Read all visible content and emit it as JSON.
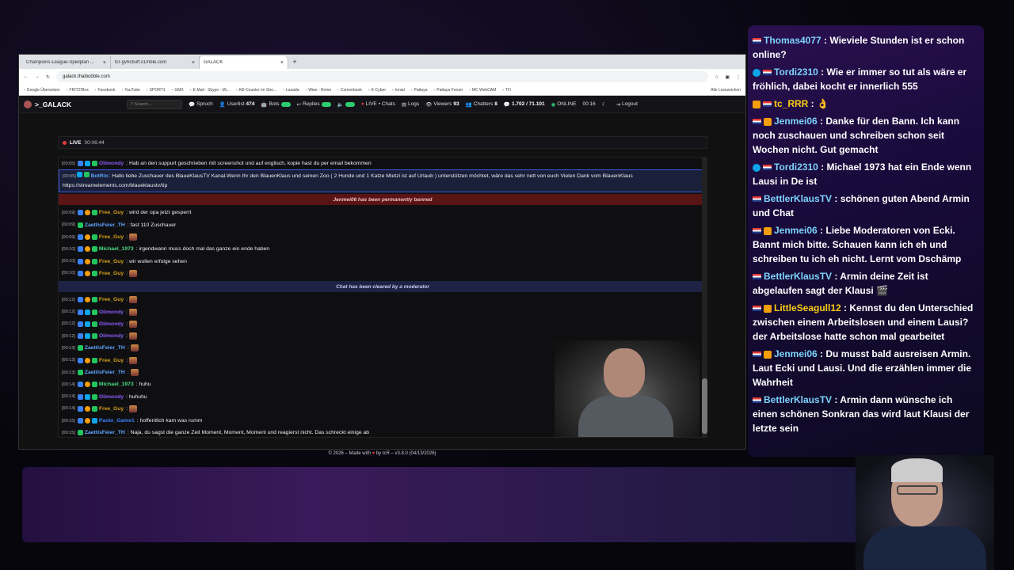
{
  "browser": {
    "tabs": [
      {
        "title": "Champions-League-Spielplan ...",
        "active": false
      },
      {
        "title": "tcr-gvhcbuff.x1mble.com",
        "active": false
      },
      {
        "title": "GALACK",
        "active": true
      }
    ],
    "url": "galack.thaibubble.com",
    "bookmarks": [
      "Google Übersetzer",
      "FRITZ!Box",
      "Facebook",
      "YouTube",
      "SPORT1",
      "GMX",
      "E-Mail - Skype - Mi...",
      "Kill-Counter im Stre...",
      "Lazada",
      "Wise - Home",
      "Comonbank",
      "K-Cyber",
      "Ionial",
      "Pattaya",
      "Pattaya Forum",
      "MC WebCAM",
      "TH"
    ],
    "bookmarks_right": "Alle Lesezeichen"
  },
  "nav": {
    "logo": ">_GALACK",
    "search_placeholder": "Search...",
    "items": {
      "spruch": "Spruch",
      "userlist": "Userlist",
      "userlist_count": "474",
      "bots": "Bots",
      "replies": "Replies",
      "live": "LIVE",
      "chats": "• Chats",
      "logs": "Logs",
      "viewers": "Viewers",
      "viewers_count": "93",
      "chatters": "Chatters",
      "chatters_count": "8",
      "messages": "1.702 / 71.101",
      "online": "ONLINE",
      "time": "00:16",
      "logout": "Logout"
    }
  },
  "livebar": {
    "label": "LIVE",
    "duration": "00:06:44"
  },
  "chat": {
    "messages": [
      {
        "type": "msg",
        "ts": "[00:05]",
        "user": "Olimondy",
        "cls": "u-olimondy",
        "badges": [
          "b-blue",
          "b-sky",
          "b-green"
        ],
        "text": ": Hab an den suppurt geschrieben mit screenshot und auf englisch, kopie hast du per email bekommen"
      },
      {
        "type": "botrix",
        "ts": "[00:05]",
        "user": "BotRix",
        "text": ": Hallo liebe Zuschauer des BlaueKlausTV Kanal.Wenn Ihr den BlauenKlaus und seinen Zoo ( 2 Hunde und 1 Katze Mietzi ist auf Urlaub ) unterstützen möchtet, wäre das sehr nett von euch Vielen Dank vom BlauenKlaus https://streamelements.com/blaueklaustv/tip"
      },
      {
        "type": "banned",
        "text": "Jenmei06 has been permanently banned"
      },
      {
        "type": "msg",
        "ts": "[00:09]",
        "user": "Free_Guy",
        "cls": "u-freeguy",
        "badges": [
          "b-blue",
          "b-orange",
          "b-green"
        ],
        "text": ": wird der opa jetzt gesperrt"
      },
      {
        "type": "msg",
        "ts": "[00:09]",
        "user": "ZaettisFeier_TH",
        "cls": "u-zaettis",
        "badges": [
          "b-green"
        ],
        "text": ": fast 110 Zuschauer"
      },
      {
        "type": "msg",
        "ts": "[00:09]",
        "user": "Free_Guy",
        "cls": "u-freeguy",
        "badges": [
          "b-blue",
          "b-orange",
          "b-green"
        ],
        "text": ":",
        "emote": true
      },
      {
        "type": "msg",
        "ts": "[00:10]",
        "user": "Michael_1973",
        "cls": "u-michael",
        "badges": [
          "b-blue",
          "b-orange",
          "b-green"
        ],
        "text": ": irgendwann muss doch mal das ganze ein ende haben"
      },
      {
        "type": "msg",
        "ts": "[00:10]",
        "user": "Free_Guy",
        "cls": "u-freeguy",
        "badges": [
          "b-blue",
          "b-orange",
          "b-green"
        ],
        "text": ": wir wollen erfolge sehen"
      },
      {
        "type": "msg",
        "ts": "[00:10]",
        "user": "Free_Guy",
        "cls": "u-freeguy",
        "badges": [
          "b-blue",
          "b-orange",
          "b-green"
        ],
        "text": ":",
        "emote": true
      },
      {
        "type": "cleared",
        "text": "Chat has been cleared by a moderator"
      },
      {
        "type": "msg",
        "ts": "[00:12]",
        "user": "Free_Guy",
        "cls": "u-freeguy",
        "badges": [
          "b-blue",
          "b-orange",
          "b-green"
        ],
        "text": ":",
        "emote": true
      },
      {
        "type": "msg",
        "ts": "[00:12]",
        "user": "Olimondy",
        "cls": "u-olimondy",
        "badges": [
          "b-blue",
          "b-sky",
          "b-green"
        ],
        "text": ":",
        "emote": true
      },
      {
        "type": "msg",
        "ts": "[00:12]",
        "user": "Olimondy",
        "cls": "u-olimondy",
        "badges": [
          "b-blue",
          "b-sky",
          "b-green"
        ],
        "text": ":",
        "emote": true
      },
      {
        "type": "msg",
        "ts": "[00:12]",
        "user": "Olimondy",
        "cls": "u-olimondy",
        "badges": [
          "b-blue",
          "b-sky",
          "b-green"
        ],
        "text": ":",
        "emote": true
      },
      {
        "type": "msg",
        "ts": "[00:13]",
        "user": "ZaettisFeier_TH",
        "cls": "u-zaettis",
        "badges": [
          "b-green"
        ],
        "text": ":",
        "emote": true
      },
      {
        "type": "msg",
        "ts": "[00:13]",
        "user": "Free_Guy",
        "cls": "u-freeguy",
        "badges": [
          "b-blue",
          "b-orange",
          "b-green"
        ],
        "text": ":",
        "emote": true
      },
      {
        "type": "msg",
        "ts": "[00:13]",
        "user": "ZaettisFeier_TH",
        "cls": "u-zaettis",
        "badges": [
          "b-green"
        ],
        "text": ":",
        "emote": true
      },
      {
        "type": "msg",
        "ts": "[00:14]",
        "user": "Michael_1973",
        "cls": "u-michael",
        "badges": [
          "b-blue",
          "b-orange",
          "b-green"
        ],
        "text": ": huhu"
      },
      {
        "type": "msg",
        "ts": "[00:14]",
        "user": "Olimondy",
        "cls": "u-olimondy",
        "badges": [
          "b-blue",
          "b-sky",
          "b-green"
        ],
        "text": ": huhuhu"
      },
      {
        "type": "msg",
        "ts": "[00:14]",
        "user": "Free_Guy",
        "cls": "u-freeguy",
        "badges": [
          "b-blue",
          "b-orange",
          "b-green"
        ],
        "text": ":",
        "emote": true
      },
      {
        "type": "msg",
        "ts": "[00:15]",
        "user": "Paolo_Game1",
        "cls": "u-paolo",
        "badges": [
          "b-blue",
          "b-orange",
          "b-sky"
        ],
        "text": ": hoffentlich kam was rumm"
      },
      {
        "type": "msg",
        "ts": "[00:15]",
        "user": "ZaettisFeier_TH",
        "cls": "u-zaettis",
        "badges": [
          "b-green"
        ],
        "text": ": Naja, du sagst die ganze Zeit Moment, Moment, Moment und reagierst nicht. Das schreckt einige ab"
      }
    ]
  },
  "footer": {
    "pre": "© 2026 – Made with",
    "post": "by tcR",
    "version": "– v3.8.0 (04/13/2026)"
  },
  "overlay": {
    "messages": [
      {
        "user": "Thomas4077",
        "cls": "",
        "badge": "flag",
        "text": " : Wieviele Stunden ist er schon online?"
      },
      {
        "user": "Tordi2310",
        "cls": "u-tordi",
        "badge": "blue-flag",
        "text": " : Wie er immer so tut als wäre er fröhlich, dabei kocht er innerlich 555"
      },
      {
        "user": "tc_RRR",
        "cls": "u-tc",
        "badge": "badge-flag",
        "text": " : 👌"
      },
      {
        "user": "Jenmei06",
        "cls": "u-jen",
        "badge": "flag-badge",
        "text": " : Danke für den Bann. Ich kann noch zuschauen und schreiben schon seit Wochen nicht. Gut gemacht"
      },
      {
        "user": "Tordi2310",
        "cls": "u-tordi",
        "badge": "blue-flag",
        "text": " : Michael 1973 hat ein Ende wenn Lausi in De ist"
      },
      {
        "user": "BettlerKlausTV",
        "cls": "u-bettler",
        "badge": "flag",
        "text": " : schönen guten Abend Armin und Chat"
      },
      {
        "user": "Jenmei06",
        "cls": "u-jen",
        "badge": "flag-badge",
        "text": " : Liebe Moderatoren von Ecki. Bannt mich bitte. Schauen kann ich eh und schreiben tu ich eh nicht. Lernt vom Dschämp"
      },
      {
        "user": "BettlerKlausTV",
        "cls": "u-bettler",
        "badge": "flag",
        "text": " : Armin deine Zeit ist abgelaufen sagt der Klausi 🎬"
      },
      {
        "user": "LittleSeagull12",
        "cls": "u-gull",
        "badge": "flag-badge",
        "text": " : Kennst du den Unterschied zwischen einem Arbeitslosen und einem Lausi? der Arbeitslose hatte schon mal gearbeitet"
      },
      {
        "user": "Jenmei06",
        "cls": "u-jen",
        "badge": "flag-badge",
        "text": " : Du musst bald ausreisen Armin. Laut Ecki und Lausi. Und die erzählen immer die Wahrheit"
      },
      {
        "user": "BettlerKlausTV",
        "cls": "u-bettler",
        "badge": "flag",
        "text": " : Armin dann wünsche ich einen schönen Sonkran das wird laut Klausi der letzte sein"
      }
    ]
  }
}
